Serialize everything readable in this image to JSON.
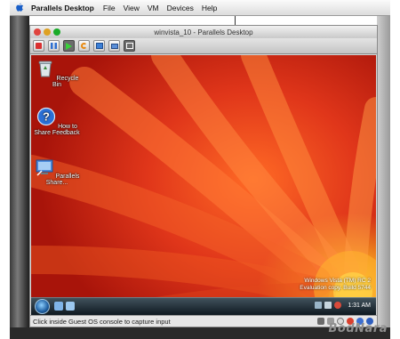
{
  "menubar": {
    "app_name": "Parallels Desktop",
    "items": [
      "File",
      "View",
      "VM",
      "Devices",
      "Help"
    ]
  },
  "window": {
    "title": "winvista_10 - Parallels Desktop"
  },
  "toolbar": {
    "buttons": [
      "stop-icon",
      "pause-icon",
      "play-icon",
      "refresh-icon",
      "windows-icon",
      "display-icon",
      "fullscreen-icon"
    ]
  },
  "desktop_icons": [
    {
      "label": "Recycle Bin",
      "icon": "recycle-bin-icon"
    },
    {
      "label": "How to Share Feedback",
      "icon": "help-icon"
    },
    {
      "label": "Parallels Share...",
      "icon": "shortcut-icon"
    }
  ],
  "watermark": {
    "line1": "Windows Vista (TM) RC 2",
    "line2": "Evaluation copy. Build 5744"
  },
  "taskbar": {
    "clock": "1:31 AM"
  },
  "statusbar": {
    "text": "Click inside Guest OS console to capture input"
  },
  "brand": {
    "text": "BodNara"
  },
  "colors": {
    "wallpaper": "#d8321a",
    "taskbar": "#1a2a34",
    "stop": "#d93030",
    "play": "#3aa83a"
  }
}
